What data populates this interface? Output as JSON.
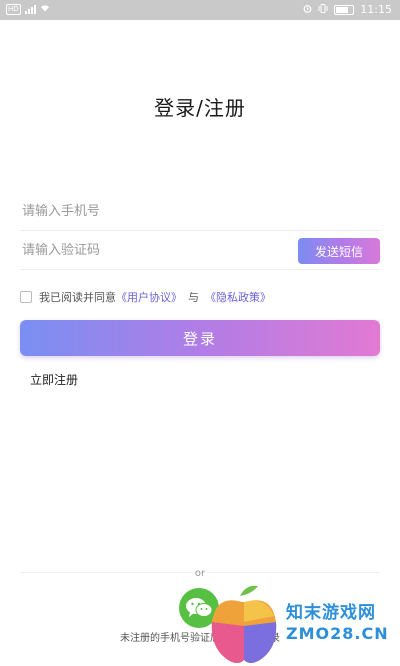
{
  "status_bar": {
    "network": "HD",
    "time": "11:15"
  },
  "page": {
    "title": "登录/注册"
  },
  "form": {
    "phone_placeholder": "请输入手机号",
    "code_placeholder": "请输入验证码",
    "send_sms_label": "发送短信"
  },
  "agreement": {
    "prefix": "我已阅读并同意",
    "user_agreement": "《用户协议》",
    "conjunction": "与",
    "privacy_policy": "《隐私政策》"
  },
  "login_button": "登录",
  "register_link": "立即注册",
  "divider": "or",
  "footer_note": "未注册的手机号验证后自动注册登录",
  "watermark": {
    "line1": "知末游戏网",
    "line2": "ZMO28.CN"
  },
  "colors": {
    "accent_start": "#7a8ff2",
    "accent_end": "#e27ad3",
    "link": "#6a63d6",
    "wechat": "#57c042",
    "watermark": "#2c8fd8"
  },
  "icons": [
    "sim-icon",
    "signal-icon",
    "wifi-icon",
    "alarm-icon",
    "vibrate-icon",
    "battery-icon",
    "wechat-icon"
  ]
}
